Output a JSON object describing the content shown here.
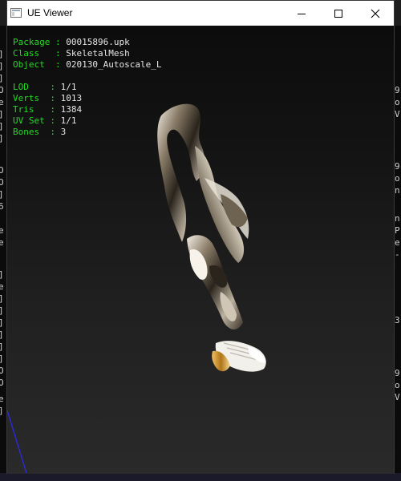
{
  "window": {
    "title": "UE Viewer"
  },
  "info": {
    "package_key": "Package",
    "package_value": "00015896.upk",
    "class_key": "Class",
    "class_value": "SkeletalMesh",
    "object_key": "Object",
    "object_value": "020130_Autoscale_L",
    "lod_key": "LOD",
    "lod_value": "1/1",
    "verts_key": "Verts",
    "verts_value": "1013",
    "tris_key": "Tris",
    "tris_value": "1384",
    "uvset_key": "UV Set",
    "uvset_value": "1/1",
    "bones_key": "Bones",
    "bones_value": "3"
  },
  "colors": {
    "label_green": "#22dd22",
    "value_white": "#e6e6e6"
  },
  "icons": {
    "app": "window-app-icon",
    "minimize": "minimize-icon",
    "maximize": "maximize-icon",
    "close": "close-icon"
  }
}
